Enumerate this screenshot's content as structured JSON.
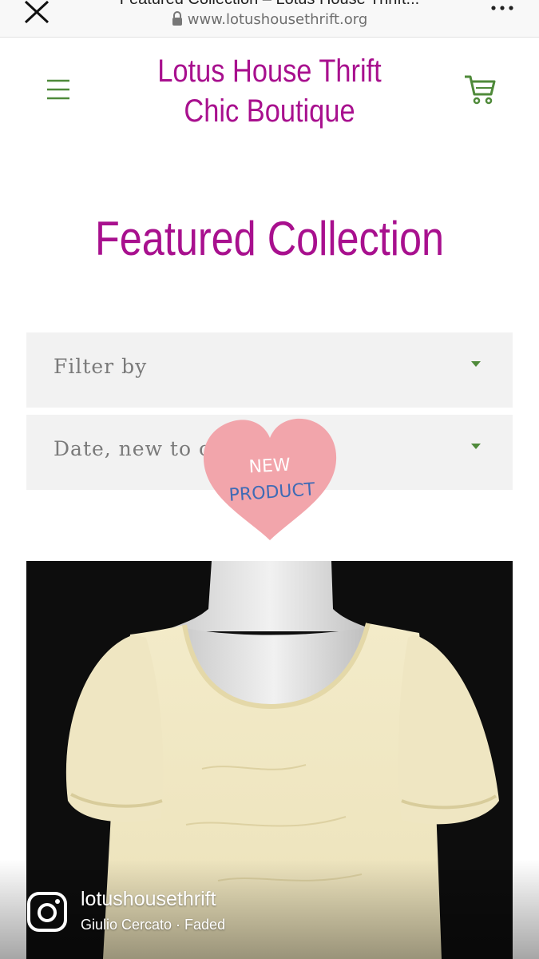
{
  "browser": {
    "tab_title": "Featured Collection – Lotus House Thrift...",
    "url": "www.lotushousethrift.org",
    "icons": [
      "close-icon",
      "lock-icon",
      "more-icon"
    ]
  },
  "header": {
    "site_title": "Lotus House Thrift Chic Boutique",
    "icons": [
      "menu-icon",
      "cart-icon"
    ],
    "brand_color": "#a8108e",
    "accent_color": "#4f8a3a"
  },
  "main": {
    "page_title": "Featured Collection",
    "filter": {
      "label": "Filter by"
    },
    "sort": {
      "label": "Date, new to old"
    },
    "sticker": {
      "line1": "NEW",
      "line2": "PRODUCT",
      "color": "#f2a5ab"
    }
  },
  "overlay": {
    "username": "lotushousethrift",
    "music": "Giulio Cercato · Faded"
  }
}
